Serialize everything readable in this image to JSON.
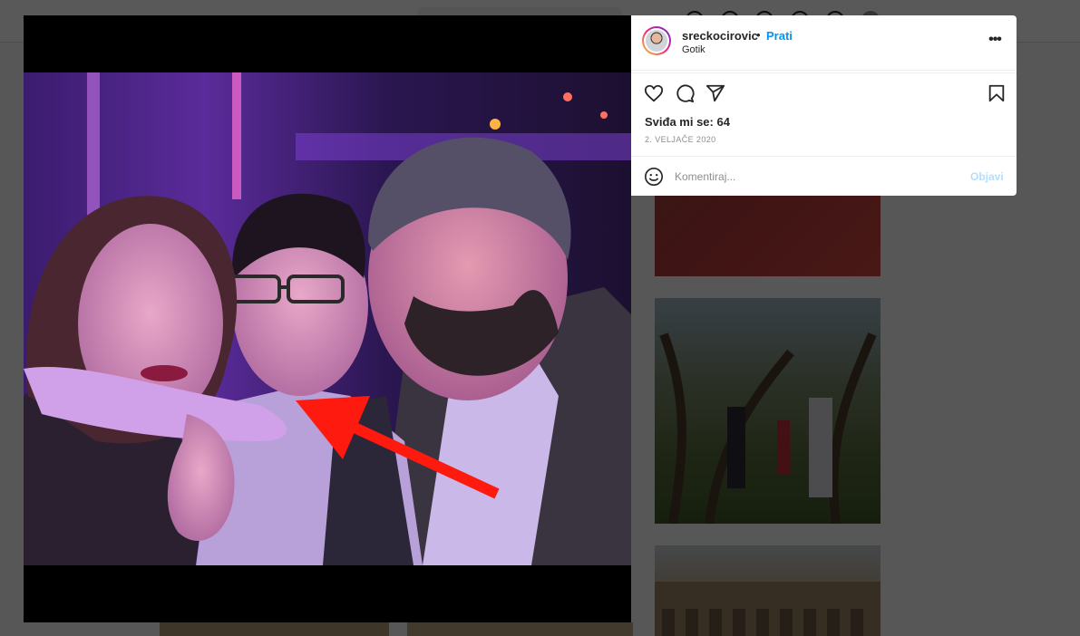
{
  "post": {
    "username": "sreckocirovic",
    "separator": "•",
    "follow_label": "Prati",
    "location": "Gotik",
    "more_label": "•••",
    "likes_text": "Sviđa mi se: 64",
    "date": "2. VELJAČE 2020"
  },
  "comment": {
    "placeholder": "Komentiraj...",
    "post_label": "Objavi"
  },
  "icons": {
    "like": "heart-icon",
    "comment": "comment-icon",
    "share": "share-icon",
    "save": "bookmark-icon",
    "emoji": "emoji-icon",
    "options": "more-options-icon"
  },
  "colors": {
    "link": "#0095f6",
    "post_disabled": "#b2dffc",
    "annotation_arrow": "#ff1a10",
    "photo_tint": "#8a3fd8"
  }
}
